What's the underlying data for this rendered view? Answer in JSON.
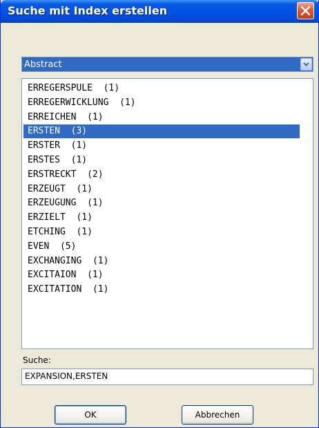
{
  "dialog": {
    "title": "Suche mit Index erstellen",
    "close_icon": "close-icon"
  },
  "field_select": {
    "value": "Abstract",
    "arrow_icon": "chevron-down-icon"
  },
  "index_list": {
    "items": [
      {
        "term": "ERREGERSPULE",
        "count": "(1)"
      },
      {
        "term": "ERREGERWICKLUNG",
        "count": "(1)"
      },
      {
        "term": "ERREICHEN",
        "count": "(1)"
      },
      {
        "term": "ERSTEN",
        "count": "(3)",
        "selected": true
      },
      {
        "term": "ERSTER",
        "count": "(1)"
      },
      {
        "term": "ERSTES",
        "count": "(1)"
      },
      {
        "term": "ERSTRECKT",
        "count": "(2)"
      },
      {
        "term": "ERZEUGT",
        "count": "(1)"
      },
      {
        "term": "ERZEUGUNG",
        "count": "(1)"
      },
      {
        "term": "ERZIELT",
        "count": "(1)"
      },
      {
        "term": "ETCHING",
        "count": "(1)"
      },
      {
        "term": "EVEN",
        "count": "(5)"
      },
      {
        "term": "EXCHANGING",
        "count": "(1)"
      },
      {
        "term": "EXCITAION",
        "count": "(1)"
      },
      {
        "term": "EXCITATION",
        "count": "(1)"
      }
    ]
  },
  "search": {
    "label": "Suche:",
    "value": "EXPANSION,ERSTEN"
  },
  "buttons": {
    "ok_label": "OK",
    "cancel_label": "Abbrechen"
  },
  "colors": {
    "title_bar": "#0054e3",
    "selection": "#316ac5",
    "dialog_bg": "#ece9d8",
    "close_button": "#e0593a"
  }
}
